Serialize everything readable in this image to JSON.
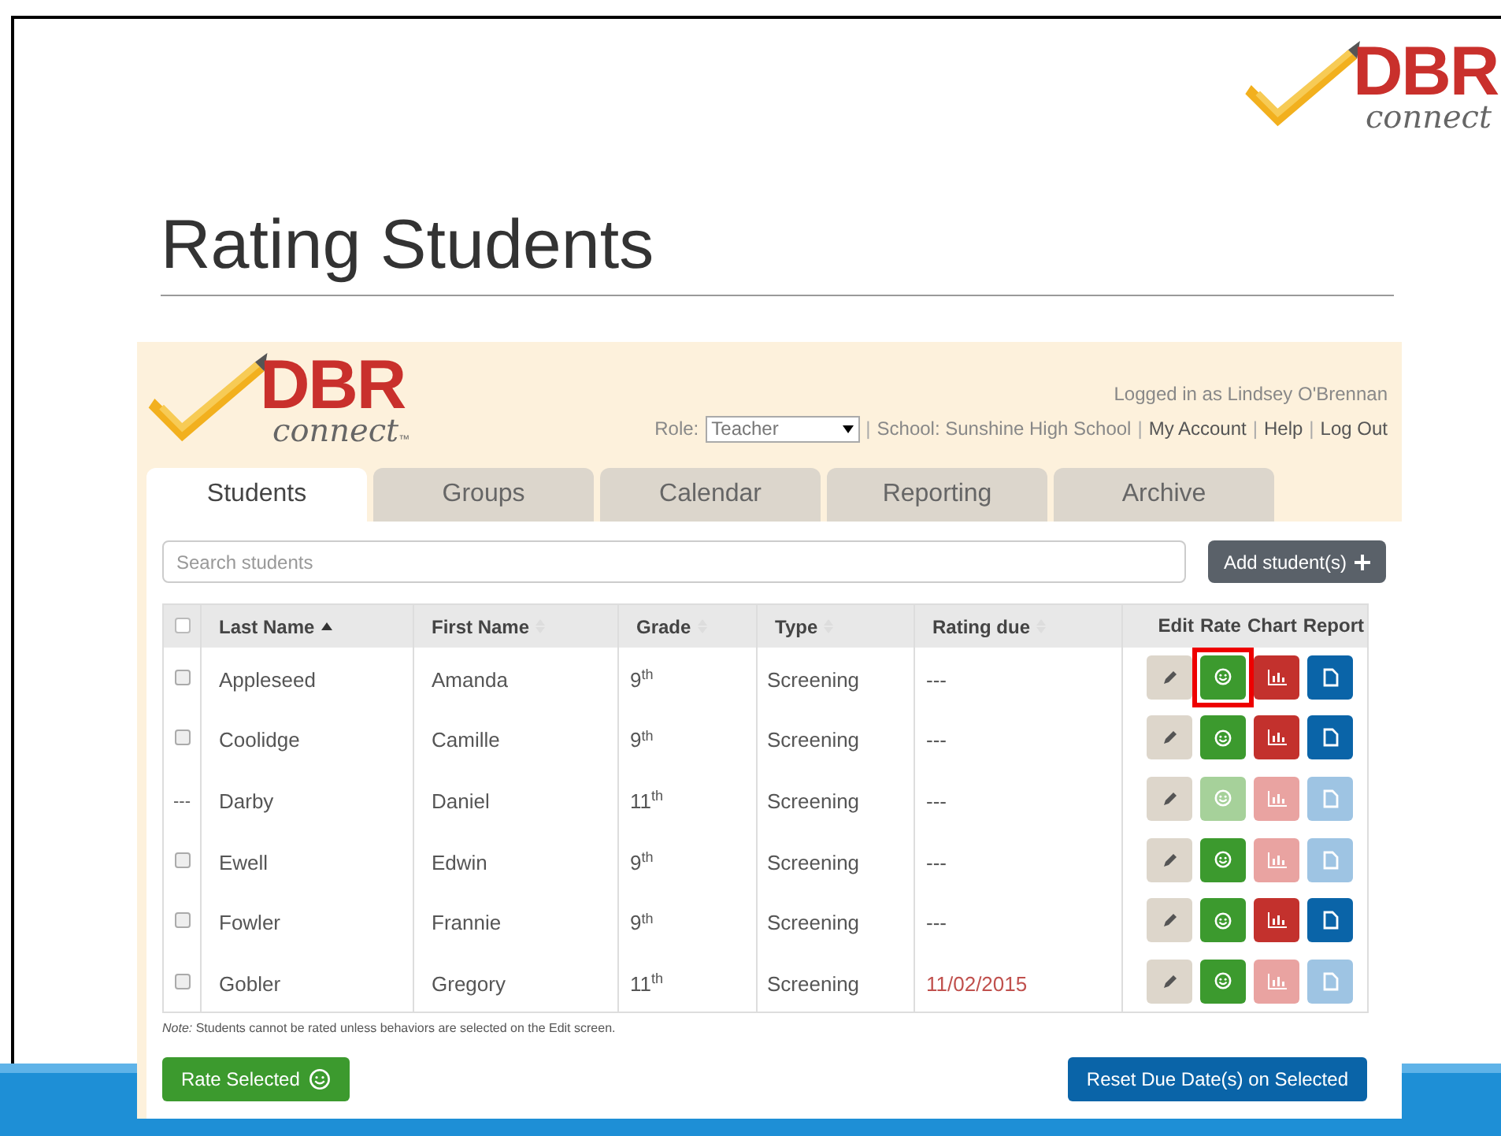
{
  "slide": {
    "title": "Rating Students",
    "logo": {
      "brand": "DBR",
      "sub": "connect"
    }
  },
  "app": {
    "logo": {
      "brand": "DBR",
      "sub": "connect",
      "tm": "™"
    },
    "user": "Logged in as Lindsey O'Brennan",
    "role_label": "Role:",
    "role": "Teacher",
    "header_items": [
      {
        "kind": "separator",
        "text": "|"
      },
      {
        "kind": "label",
        "text": "School: Sunshine High School"
      },
      {
        "kind": "separator",
        "text": "|"
      },
      {
        "kind": "link",
        "text": "My Account"
      },
      {
        "kind": "separator",
        "text": "|"
      },
      {
        "kind": "link",
        "text": "Help"
      },
      {
        "kind": "separator",
        "text": "|"
      },
      {
        "kind": "link",
        "text": "Log Out"
      }
    ],
    "tabs": [
      {
        "label": "Students",
        "selected": true
      },
      {
        "label": "Groups",
        "selected": false
      },
      {
        "label": "Calendar",
        "selected": false
      },
      {
        "label": "Reporting",
        "selected": false
      },
      {
        "label": "Archive",
        "selected": false
      }
    ],
    "search": {
      "placeholder": "Search students"
    },
    "add_button": "Add student(s)",
    "table": {
      "select_all_checked": false,
      "columns": [
        {
          "label": "Last Name",
          "sorted": true
        },
        {
          "label": "First Name",
          "sorted": false
        },
        {
          "label": "Grade",
          "sorted": false
        },
        {
          "label": "Type",
          "sorted": false
        },
        {
          "label": "Rating due",
          "sorted": false
        }
      ],
      "action_columns": [
        "Edit",
        "Rate",
        "Chart",
        "Report"
      ],
      "rows": [
        {
          "kind": "checkbox",
          "checked": false,
          "last": "Appleseed",
          "first": "Amanda",
          "grade": "9$^{th}$",
          "type": "Screening",
          "due": "---",
          "overdue": false,
          "rate_enabled": true,
          "chart_enabled": true,
          "report_enabled": true,
          "highlighted": true
        },
        {
          "kind": "checkbox",
          "checked": false,
          "last": "Coolidge",
          "first": "Camille",
          "grade": "9$^{th}$",
          "type": "Screening",
          "due": "---",
          "overdue": false,
          "rate_enabled": true,
          "chart_enabled": true,
          "report_enabled": true,
          "highlighted": false
        },
        {
          "kind": "none",
          "mark": "---",
          "last": "Darby",
          "first": "Daniel",
          "grade": "11$^{th}$",
          "type": "Screening",
          "due": "---",
          "overdue": false,
          "rate_enabled": false,
          "chart_enabled": false,
          "report_enabled": false,
          "highlighted": false
        },
        {
          "kind": "checkbox",
          "checked": false,
          "last": "Ewell",
          "first": "Edwin",
          "grade": "9$^{th}$",
          "type": "Screening",
          "due": "---",
          "overdue": false,
          "rate_enabled": true,
          "chart_enabled": false,
          "report_enabled": false,
          "highlighted": false
        },
        {
          "kind": "checkbox",
          "checked": false,
          "last": "Fowler",
          "first": "Frannie",
          "grade": "9$^{th}$",
          "type": "Screening",
          "due": "---",
          "overdue": false,
          "rate_enabled": true,
          "chart_enabled": true,
          "report_enabled": true,
          "highlighted": false
        },
        {
          "kind": "checkbox",
          "checked": false,
          "last": "Gobler",
          "first": "Gregory",
          "grade": "11$^{th}$",
          "type": "Screening",
          "due": "11/02/2015",
          "overdue": true,
          "rate_enabled": true,
          "chart_enabled": false,
          "report_enabled": false,
          "highlighted": false
        }
      ]
    },
    "note": "*Note:* Students cannot be rated unless behaviors are selected on the Edit screen.",
    "rate_selected": "Rate Selected",
    "reset_button": "Reset Due Date(s) on Selected"
  }
}
